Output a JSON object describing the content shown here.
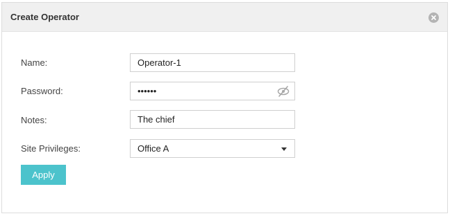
{
  "dialog": {
    "title": "Create Operator",
    "close_icon": "close-circle-icon"
  },
  "form": {
    "name": {
      "label": "Name:",
      "value": "Operator-1"
    },
    "password": {
      "label": "Password:",
      "value": "••••••",
      "toggle_icon": "eye-slash-icon"
    },
    "notes": {
      "label": "Notes:",
      "value": "The chief"
    },
    "site_privileges": {
      "label": "Site Privileges:",
      "selected": "Office A",
      "dropdown_icon": "caret-down-icon"
    }
  },
  "actions": {
    "apply_label": "Apply",
    "apply_color": "#4cc3cc"
  }
}
